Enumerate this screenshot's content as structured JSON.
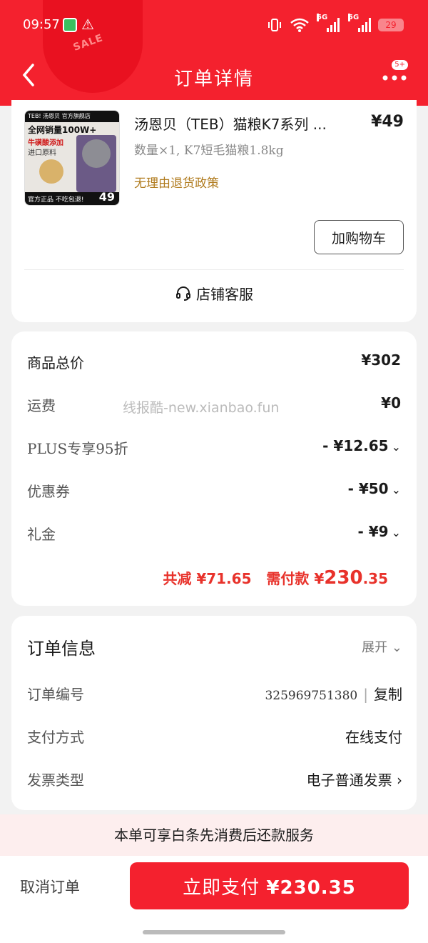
{
  "status_bar": {
    "time": "09:57",
    "network_1": "5G",
    "network_2": "5G",
    "battery": "29"
  },
  "header": {
    "title": "订单详情",
    "more_badge": "5+",
    "sale_tag": "SALE",
    "brand_color": "#f4212e"
  },
  "product": {
    "title": "汤恩贝（TEB）猫粮K7系列 ...",
    "price": "¥49",
    "spec": "数量×1, K7短毛猫粮1.8kg",
    "policy": "无理由退货政策",
    "add_cart_label": "加购物车",
    "thumb": {
      "brand": "TEB! 汤恩贝 官方旗舰店",
      "line1": "全网销量100W+",
      "line2": "牛磺酸添加",
      "line3": "进口原料",
      "bottom": "官方正品 不吃包退!",
      "price": "49"
    }
  },
  "service": {
    "label": "店铺客服"
  },
  "price_detail": {
    "total_label": "商品总价",
    "total_value": "¥302",
    "shipping_label": "运费",
    "shipping_value": "¥0",
    "plus_label": "PLUS专享95折",
    "plus_value": "- ¥12.65",
    "coupon_label": "优惠券",
    "coupon_value": "- ¥50",
    "gift_label": "礼金",
    "gift_value": "- ¥9",
    "watermark": "线报酷-new.xianbao.fun",
    "saved_text": "共减 ¥71.65",
    "pay_label": "需付款 ¥",
    "pay_int": "230",
    "pay_dec": ".35",
    "accent_color": "#e8322b"
  },
  "order_info": {
    "title": "订单信息",
    "expand_label": "展开",
    "order_no_label": "订单编号",
    "order_no": "325969751380",
    "copy_label": "复制",
    "payment_label": "支付方式",
    "payment_value": "在线支付",
    "invoice_label": "发票类型",
    "invoice_value": "电子普通发票"
  },
  "banner": {
    "text": "本单可享白条先消费后还款服务"
  },
  "bottom": {
    "cancel_label": "取消订单",
    "pay_label": "立即支付",
    "pay_amount": "¥230.35"
  }
}
